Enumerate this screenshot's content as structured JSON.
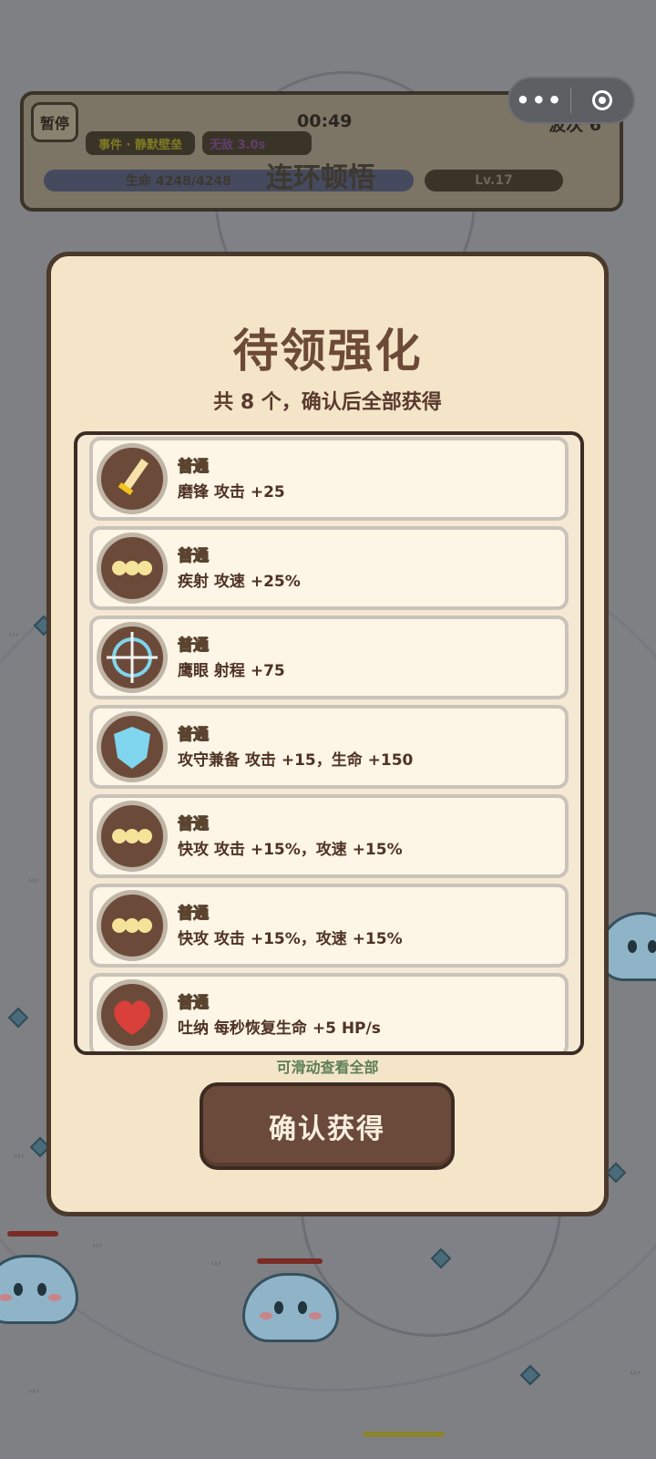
{
  "hud": {
    "pause_label": "暂停",
    "timer": "00:49",
    "wave": "波次 6",
    "event": "事件 · 静默壁垒",
    "invincible": "无敌 3.0s",
    "hp": "生命 4248/4248",
    "combo_text": "连环顿悟",
    "level": "Lv.17"
  },
  "capsule": {
    "more_label": "•••"
  },
  "modal": {
    "title": "待领强化",
    "subtitle": "共 8 个，确认后全部获得",
    "scroll_hint": "可滑动查看全部",
    "confirm_label": "确认获得",
    "items": [
      {
        "rarity": "普通",
        "desc": "磨锋  攻击 +25",
        "icon": "sword-icon"
      },
      {
        "rarity": "普通",
        "desc": "疾射  攻速 +25%",
        "icon": "triple-dot-icon"
      },
      {
        "rarity": "普通",
        "desc": "鹰眼  射程 +75",
        "icon": "crosshair-icon"
      },
      {
        "rarity": "普通",
        "desc": "攻守兼备  攻击 +15，生命 +150",
        "icon": "shield-icon"
      },
      {
        "rarity": "普通",
        "desc": "快攻  攻击 +15%，攻速 +15%",
        "icon": "triple-dot-icon"
      },
      {
        "rarity": "普通",
        "desc": "快攻  攻击 +15%，攻速 +15%",
        "icon": "triple-dot-icon"
      },
      {
        "rarity": "普通",
        "desc": "吐纳  每秒恢复生命 +5 HP/s",
        "icon": "heart-icon"
      }
    ]
  },
  "colors": {
    "panel": "#f4e5c8",
    "panel_border": "#4a3a2c",
    "button": "#6b4a3b",
    "hint_green": "#5c7e56"
  }
}
